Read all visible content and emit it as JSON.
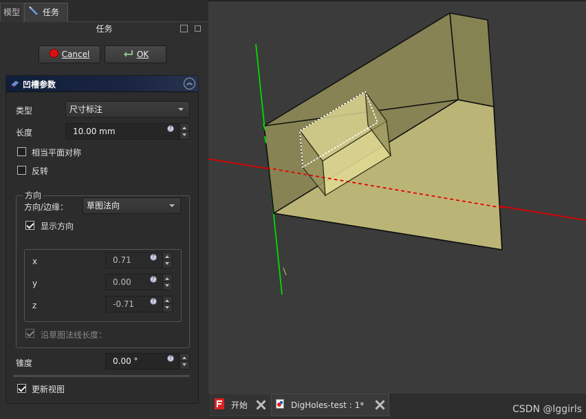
{
  "tabs": {
    "model": "模型",
    "task": "任务"
  },
  "panel_title": "任务",
  "buttons": {
    "cancel": "Cancel",
    "ok": "OK"
  },
  "section_title": "凹槽参数",
  "type": {
    "label": "类型",
    "value": "尺寸标注"
  },
  "length": {
    "label": "长度",
    "value": "10.00 mm"
  },
  "symmetric": {
    "label": "相当平面对称",
    "checked": false
  },
  "reversed": {
    "label": "反转",
    "checked": false
  },
  "direction": {
    "group_title": "方向",
    "edge_label": "方向/边缘：",
    "edge_value": "草图法向",
    "show_label": "显示方向",
    "show_checked": true,
    "x": {
      "label": "x",
      "value": "0.71"
    },
    "y": {
      "label": "y",
      "value": "0.00"
    },
    "z": {
      "label": "z",
      "value": "-0.71"
    },
    "along_normal_label": "沿草图法线长度："
  },
  "taper": {
    "label": "锥度",
    "value": "0.00 °"
  },
  "update_view": {
    "label": "更新视图",
    "checked": true
  },
  "doc_tabs": {
    "start": "开始",
    "doc": "DigHoles-test : 1*"
  },
  "watermark": "CSDN @lggirls",
  "colors": {
    "background": "#3b3b3b",
    "solid_face": "#b7b26a",
    "x_axis": "#dd0000",
    "y_axis": "#00dd00"
  }
}
